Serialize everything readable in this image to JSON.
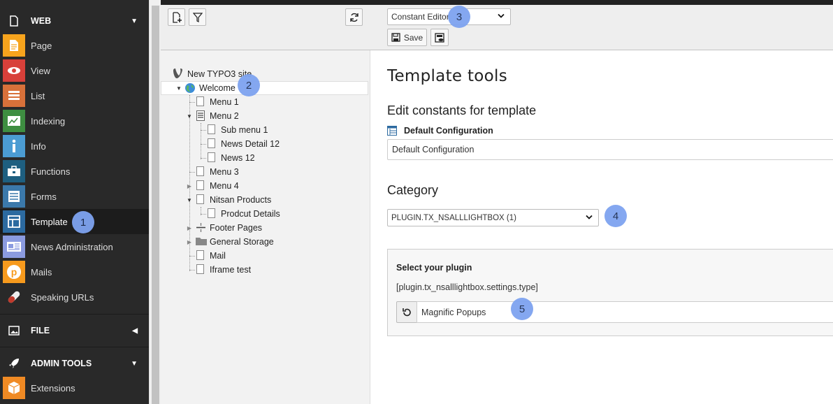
{
  "module_menu": {
    "groups": [
      {
        "label": "WEB",
        "icon": "page-icon",
        "expanded": true
      },
      {
        "label": "FILE",
        "icon": "image-icon",
        "expanded": false
      },
      {
        "label": "ADMIN TOOLS",
        "icon": "rocket-icon",
        "expanded": true
      }
    ],
    "web_items": [
      {
        "label": "Page",
        "icon": "page-module-icon",
        "color": "#f7a41d"
      },
      {
        "label": "View",
        "icon": "eye-icon",
        "color": "#d8403a"
      },
      {
        "label": "List",
        "icon": "list-icon",
        "color": "#d8713a"
      },
      {
        "label": "Indexing",
        "icon": "chart-icon",
        "color": "#3e8e41"
      },
      {
        "label": "Info",
        "icon": "info-icon",
        "color": "#4b9cd3"
      },
      {
        "label": "Functions",
        "icon": "briefcase-icon",
        "color": "#1e5f80"
      },
      {
        "label": "Forms",
        "icon": "forms-icon",
        "color": "#3b79ab"
      },
      {
        "label": "Template",
        "icon": "template-icon",
        "color": "#2c6aa0"
      },
      {
        "label": "News Administration",
        "icon": "news-icon",
        "color": "#8b9be0"
      },
      {
        "label": "Mails",
        "icon": "mails-icon",
        "color": "#f79a1d"
      },
      {
        "label": "Speaking URLs",
        "icon": "pill-icon",
        "color": "#c0392b"
      }
    ],
    "admin_items": [
      {
        "label": "Extensions",
        "icon": "extensions-icon",
        "color": "#f08a24"
      }
    ],
    "active": "Template"
  },
  "docheader": {
    "function_select": "Constant Editor",
    "save_label": "Save"
  },
  "page_tree": {
    "root": "New TYPO3 site",
    "nodes": [
      {
        "label": "Welcome",
        "level": 1,
        "toggle": "open",
        "selected": true
      },
      {
        "label": "Menu 1",
        "level": 2,
        "toggle": ""
      },
      {
        "label": "Menu 2",
        "level": 2,
        "toggle": "open"
      },
      {
        "label": "Sub menu 1",
        "level": 3,
        "toggle": ""
      },
      {
        "label": "News Detail 12",
        "level": 3,
        "toggle": ""
      },
      {
        "label": "News 12",
        "level": 3,
        "toggle": ""
      },
      {
        "label": "Menu 3",
        "level": 2,
        "toggle": ""
      },
      {
        "label": "Menu 4",
        "level": 2,
        "toggle": "closed"
      },
      {
        "label": "Nitsan Products",
        "level": 2,
        "toggle": "open"
      },
      {
        "label": "Prodcut Details",
        "level": 3,
        "toggle": ""
      },
      {
        "label": "Footer Pages",
        "level": 2,
        "toggle": "closed"
      },
      {
        "label": "General Storage",
        "level": 2,
        "toggle": "closed"
      },
      {
        "label": "Mail",
        "level": 2,
        "toggle": ""
      },
      {
        "label": "Iframe test",
        "level": 2,
        "toggle": ""
      }
    ]
  },
  "content": {
    "title": "Template tools",
    "subtitle": "Edit constants for template",
    "template_record": "Default Configuration",
    "template_field": "Default Configuration",
    "category_heading": "Category",
    "category_select": "PLUGIN.TX_NSALLLIGHTBOX (1)",
    "plugin_panel": {
      "title": "Select your plugin",
      "key": "[plugin.tx_nsalllightbox.settings.type]",
      "value": "Magnific Popups"
    }
  },
  "badges": [
    "1",
    "2",
    "3",
    "4",
    "5"
  ]
}
